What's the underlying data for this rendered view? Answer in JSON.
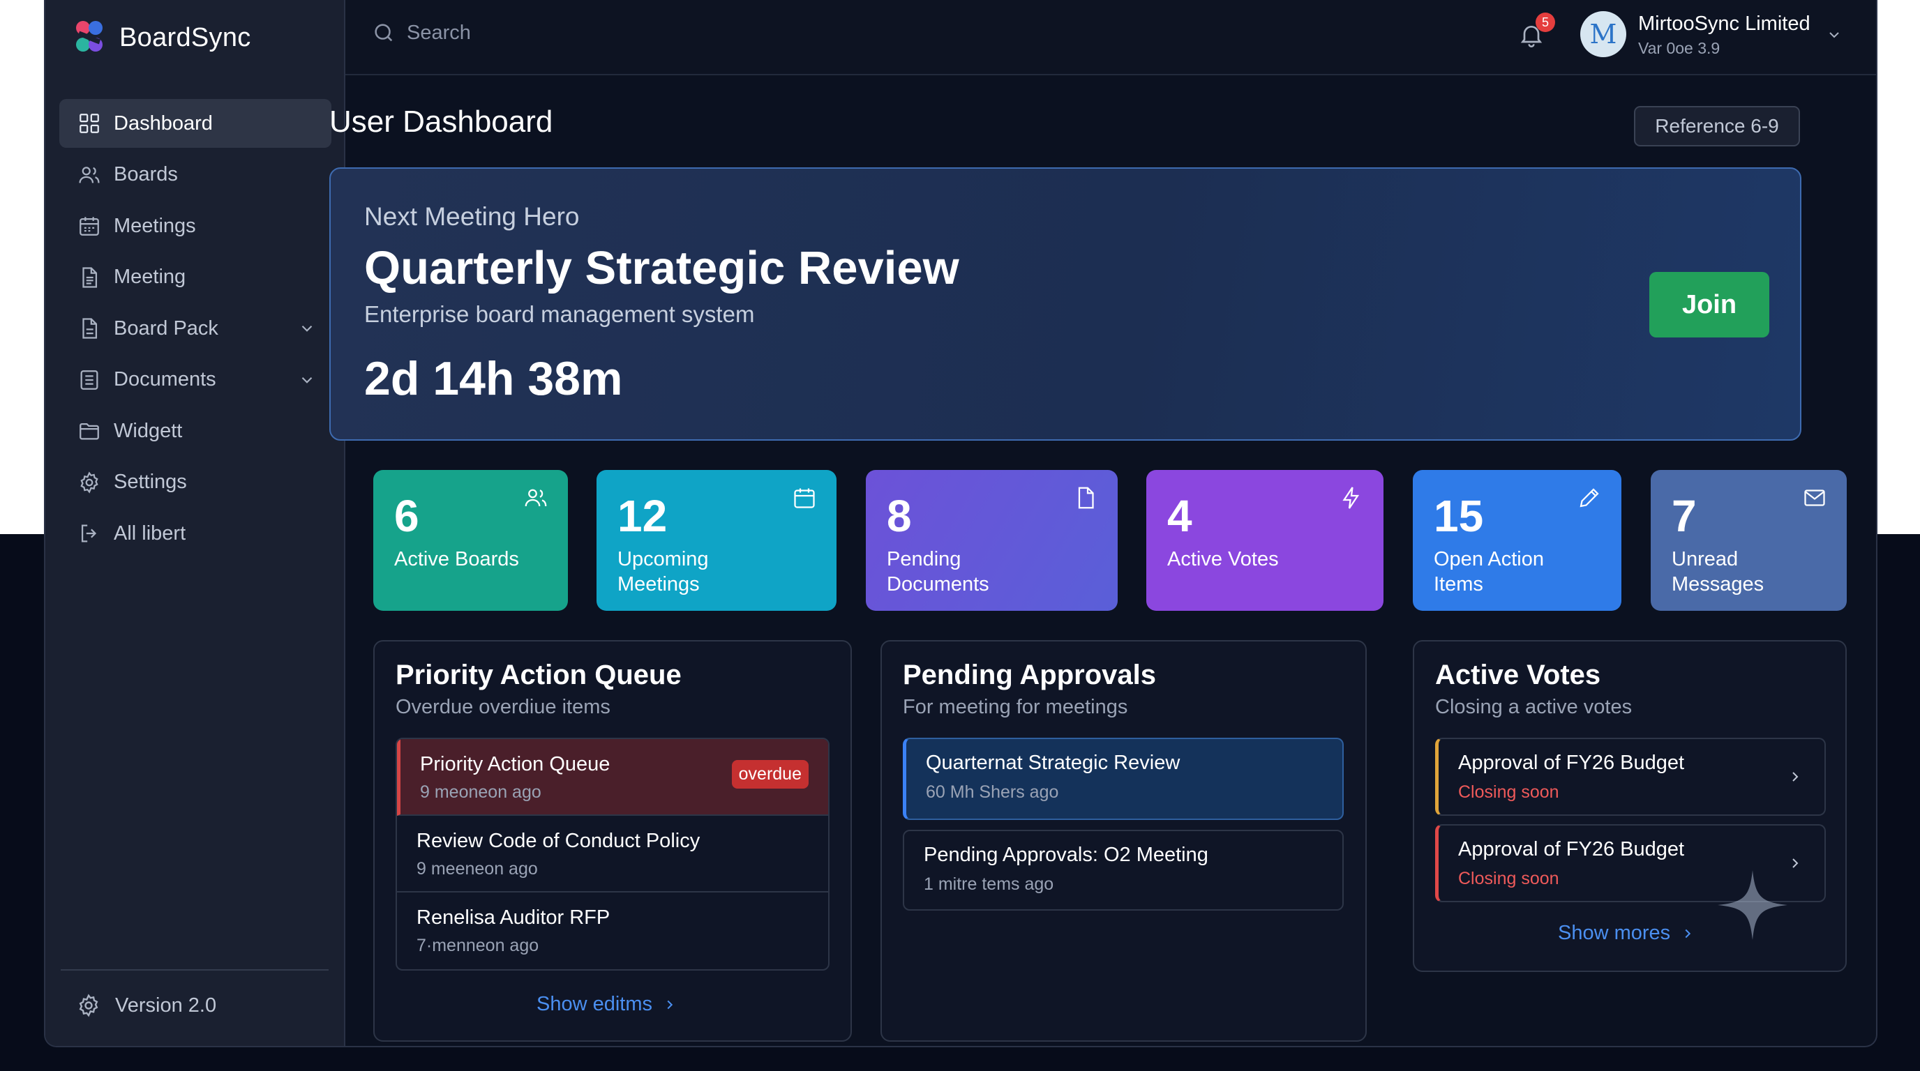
{
  "app": {
    "name": "BoardSync"
  },
  "sidebar": {
    "items": [
      {
        "label": "Dashboard",
        "icon": "grid-icon",
        "active": true
      },
      {
        "label": "Boards",
        "icon": "users-icon"
      },
      {
        "label": "Meetings",
        "icon": "calendar-icon"
      },
      {
        "label": "Meeting",
        "icon": "document-icon"
      },
      {
        "label": "Board Pack",
        "icon": "document-icon",
        "expandable": true
      },
      {
        "label": "Documents",
        "icon": "list-document-icon",
        "expandable": true
      },
      {
        "label": "Widgett",
        "icon": "folder-icon"
      },
      {
        "label": "Settings",
        "icon": "gear-icon"
      },
      {
        "label": "All libert",
        "icon": "logout-icon"
      }
    ],
    "version": "Version 2.0"
  },
  "topbar": {
    "search_placeholder": "Search",
    "notifications_count": "5",
    "user_name": "MirtooSync Limited",
    "user_sub": "Var 0oe 3.9",
    "avatar_letter": "M"
  },
  "page": {
    "title": "User Dashboard",
    "reference_button": "Reference 6-9"
  },
  "hero": {
    "kicker": "Next Meeting Hero",
    "title": "Quarterly Strategic Review",
    "subtitle": "Enterprise board management system",
    "countdown": "2d 14h 38m",
    "join_label": "Join"
  },
  "stats": [
    {
      "value": "6",
      "label": "Active Boards",
      "icon": "users-icon",
      "color": "#16a38b"
    },
    {
      "value": "12",
      "label": "Upcoming Meetings",
      "icon": "calendar-icon",
      "color": "#0fa4c6"
    },
    {
      "value": "8",
      "label": "Pending Documents",
      "icon": "document-icon",
      "color": "#6a55d9"
    },
    {
      "value": "4",
      "label": "Active Votes",
      "icon": "lightning-icon",
      "color": "#8b47df"
    },
    {
      "value": "15",
      "label": "Open Action Items",
      "icon": "pencil-icon",
      "color": "#2f7be8"
    },
    {
      "value": "7",
      "label": "Unread Messages",
      "icon": "mail-icon",
      "color": "#4a6aa8"
    }
  ],
  "priority": {
    "title": "Priority Action Queue",
    "subtitle": "Overdue overdiue items",
    "items": [
      {
        "title": "Priority Action Queue",
        "sub": "9 meoneon ago",
        "badge": "overdue"
      },
      {
        "title": "Review Code of Conduct Policy",
        "sub": "9 meeneon ago"
      },
      {
        "title": "Renelisa Auditor RFP",
        "sub": "7·menneon ago"
      }
    ],
    "link": "Show editms"
  },
  "approvals": {
    "title": "Pending Approvals",
    "subtitle": "For meeting for meetings",
    "items": [
      {
        "title": "Quarternat Strategic Review",
        "sub": "60 Mh Shers ago"
      },
      {
        "title": "Pending Approvals: O2 Meeting",
        "sub": "1 mitre tems ago"
      }
    ]
  },
  "votes": {
    "title": "Active Votes",
    "subtitle": "Closing a active votes",
    "items": [
      {
        "title": "Approval of FY26 Budget",
        "sub": "Closing soon",
        "accent": "#e0a43a"
      },
      {
        "title": "Approval of FY26 Budget",
        "sub": "Closing soon",
        "accent": "#e04848"
      }
    ],
    "link": "Show mores"
  }
}
